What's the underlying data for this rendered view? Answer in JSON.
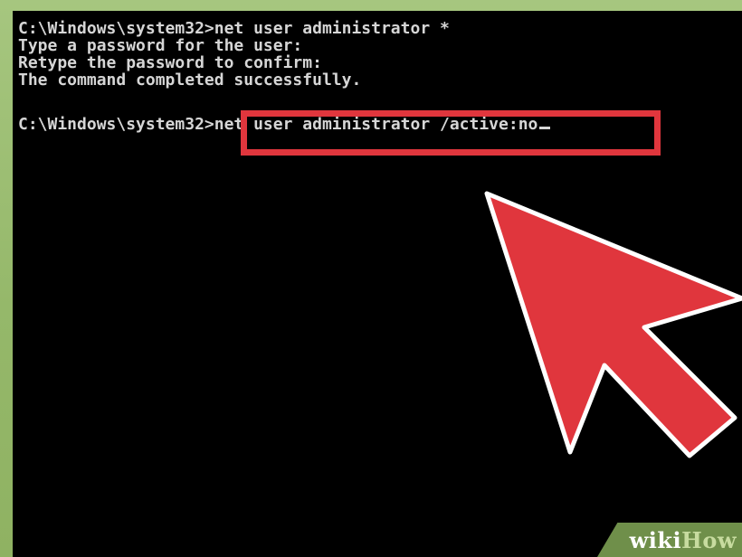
{
  "console": {
    "lines": [
      "C:\\Windows\\system32>net user administrator *",
      "Type a password for the user:",
      "Retype the password to confirm:",
      "The command completed successfully."
    ],
    "prompt": "C:\\Windows\\system32>",
    "command": "net user administrator /active:no"
  },
  "colors": {
    "background_green": "#9bbd73",
    "terminal_bg": "#000000",
    "terminal_text": "#d6d6d6",
    "highlight_red": "#e0363d"
  },
  "watermark": {
    "part1": "wiki",
    "part2": "How"
  },
  "annotations": {
    "arrow": "red-arrow-pointing-up-left",
    "highlight": "red-rectangle-around-command"
  }
}
